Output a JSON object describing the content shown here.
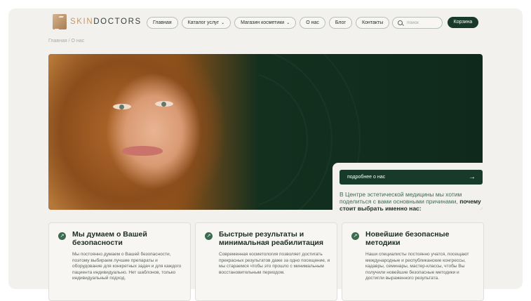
{
  "header": {
    "logo_prefix": "SKIN",
    "logo_suffix": "DOCTORS",
    "nav": [
      {
        "label": "Главная",
        "has_dropdown": false
      },
      {
        "label": "Каталог услуг",
        "has_dropdown": true
      },
      {
        "label": "Магазин косметики",
        "has_dropdown": true
      },
      {
        "label": "О нас",
        "has_dropdown": false
      },
      {
        "label": "Блог",
        "has_dropdown": false
      },
      {
        "label": "Контакты",
        "has_dropdown": false
      }
    ],
    "search_placeholder": "поиск",
    "cart_label": "Корзина"
  },
  "breadcrumb": {
    "home": "Главная",
    "separator": "/",
    "current": "О нас"
  },
  "hero": {
    "button_label": "подробнее о нас",
    "button_icon": "arrow-right-icon",
    "text": "В Центре эстетической медицины мы хотим поделиться с вами основными причинами,",
    "text_strong": "почему стоит выбрать именно нас:"
  },
  "cards": [
    {
      "icon": "arrow-up-right-icon",
      "title": "Мы думаем о Вашей безопасности",
      "text": "Мы постоянно думаем о Вашей безопасности, поэтому выбираем лучшие препараты и оборудование для конкретных задач и для каждого пациента индивидуально. Нет шаблонов, только индивидуальный подход."
    },
    {
      "icon": "arrow-up-right-icon",
      "title": "Быстрые результаты и минимальная реабилитация",
      "text": "Современная косметология позволяет достигать прекрасных результатов даже за одно посещение, и мы стараемся чтобы это прошло с минимальным восстановительным периодом."
    },
    {
      "icon": "arrow-up-right-icon",
      "title": "Новейшие безопасные методики",
      "text": "Наши специалисты постоянно учатся, посещают международные и республиканские конгрессы, кадавры, семинары, мастер-классы, чтобы Вы получили новейшие безопасные методики и достигли выраженного результата."
    }
  ],
  "colors": {
    "accent": "#173a2a",
    "brand_gold": "#c49a6c",
    "background": "#f2f1ee"
  }
}
